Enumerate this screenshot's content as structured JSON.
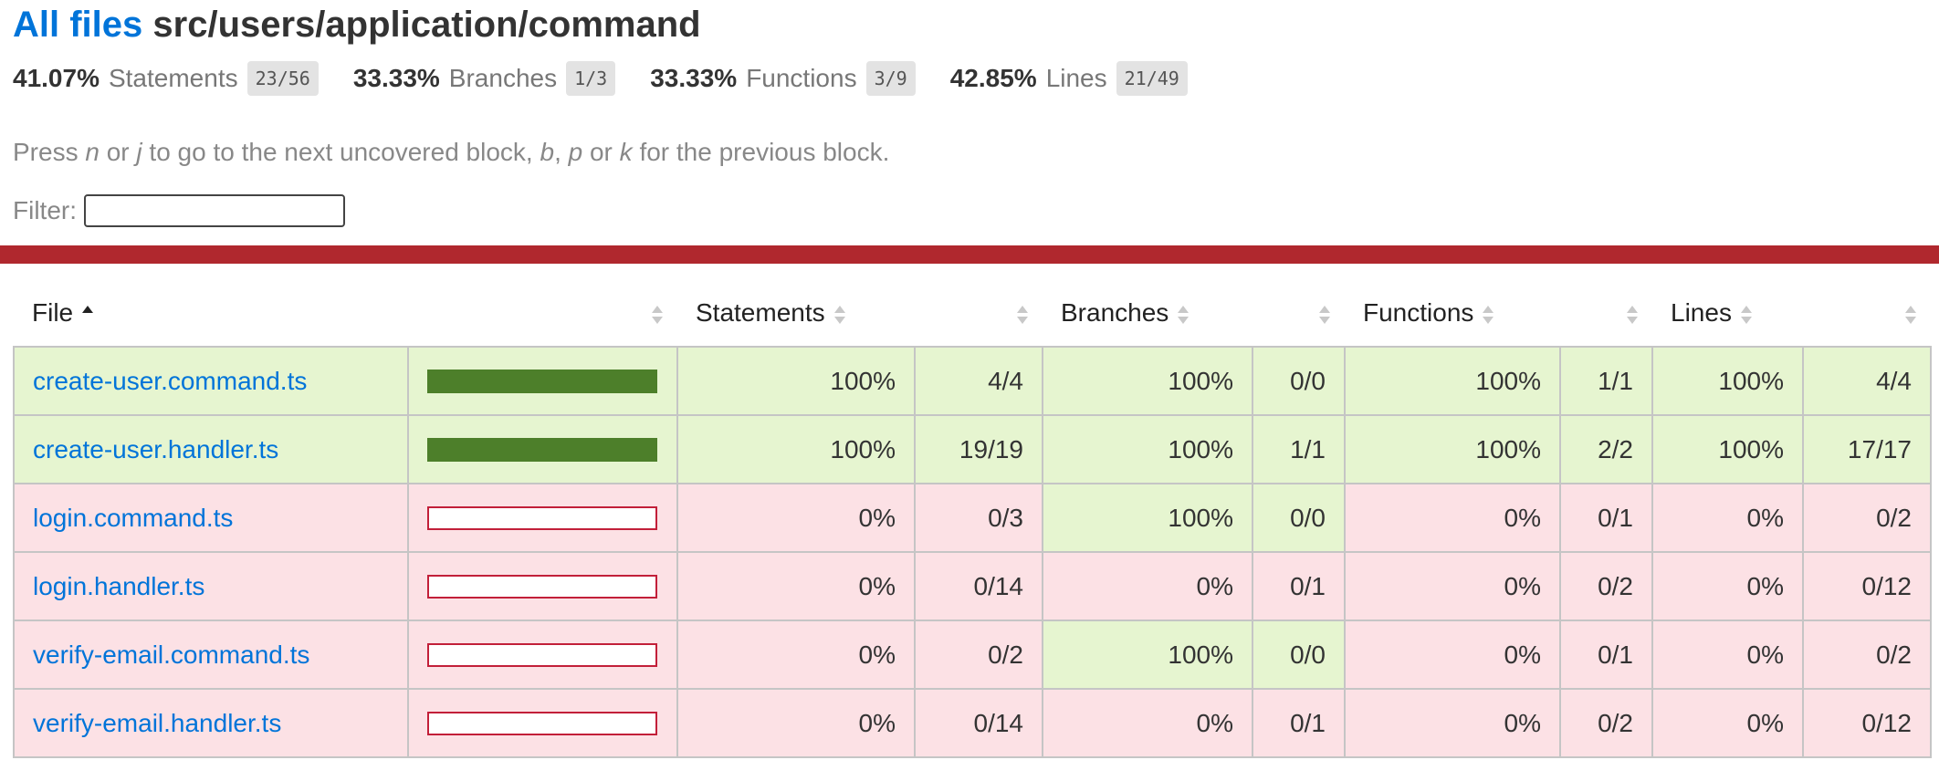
{
  "breadcrumb": {
    "root_link": "All files",
    "path": "src/users/application/command"
  },
  "summary": [
    {
      "pct": "41.07%",
      "label": "Statements",
      "fraction": "23/56"
    },
    {
      "pct": "33.33%",
      "label": "Branches",
      "fraction": "1/3"
    },
    {
      "pct": "33.33%",
      "label": "Functions",
      "fraction": "3/9"
    },
    {
      "pct": "42.85%",
      "label": "Lines",
      "fraction": "21/49"
    }
  ],
  "help": {
    "t1": "Press ",
    "k1": "n",
    "t2": " or ",
    "k2": "j",
    "t3": " to go to the next uncovered block, ",
    "k3": "b",
    "t4": ", ",
    "k4": "p",
    "t5": " or ",
    "k5": "k",
    "t6": " for the previous block."
  },
  "filter": {
    "label": "Filter:",
    "value": ""
  },
  "table": {
    "headers": {
      "file": "File",
      "statements": "Statements",
      "branches": "Branches",
      "functions": "Functions",
      "lines": "Lines"
    },
    "rows": [
      {
        "file": "create-user.command.ts",
        "coverage": 100,
        "status": "high",
        "statements": {
          "pct": "100%",
          "frac": "4/4",
          "status": "high"
        },
        "branches": {
          "pct": "100%",
          "frac": "0/0",
          "status": "high"
        },
        "functions": {
          "pct": "100%",
          "frac": "1/1",
          "status": "high"
        },
        "lines": {
          "pct": "100%",
          "frac": "4/4",
          "status": "high"
        }
      },
      {
        "file": "create-user.handler.ts",
        "coverage": 100,
        "status": "high",
        "statements": {
          "pct": "100%",
          "frac": "19/19",
          "status": "high"
        },
        "branches": {
          "pct": "100%",
          "frac": "1/1",
          "status": "high"
        },
        "functions": {
          "pct": "100%",
          "frac": "2/2",
          "status": "high"
        },
        "lines": {
          "pct": "100%",
          "frac": "17/17",
          "status": "high"
        }
      },
      {
        "file": "login.command.ts",
        "coverage": 0,
        "status": "low",
        "statements": {
          "pct": "0%",
          "frac": "0/3",
          "status": "low"
        },
        "branches": {
          "pct": "100%",
          "frac": "0/0",
          "status": "high"
        },
        "functions": {
          "pct": "0%",
          "frac": "0/1",
          "status": "low"
        },
        "lines": {
          "pct": "0%",
          "frac": "0/2",
          "status": "low"
        }
      },
      {
        "file": "login.handler.ts",
        "coverage": 0,
        "status": "low",
        "statements": {
          "pct": "0%",
          "frac": "0/14",
          "status": "low"
        },
        "branches": {
          "pct": "0%",
          "frac": "0/1",
          "status": "low"
        },
        "functions": {
          "pct": "0%",
          "frac": "0/2",
          "status": "low"
        },
        "lines": {
          "pct": "0%",
          "frac": "0/12",
          "status": "low"
        }
      },
      {
        "file": "verify-email.command.ts",
        "coverage": 0,
        "status": "low",
        "statements": {
          "pct": "0%",
          "frac": "0/2",
          "status": "low"
        },
        "branches": {
          "pct": "100%",
          "frac": "0/0",
          "status": "high"
        },
        "functions": {
          "pct": "0%",
          "frac": "0/1",
          "status": "low"
        },
        "lines": {
          "pct": "0%",
          "frac": "0/2",
          "status": "low"
        }
      },
      {
        "file": "verify-email.handler.ts",
        "coverage": 0,
        "status": "low",
        "statements": {
          "pct": "0%",
          "frac": "0/14",
          "status": "low"
        },
        "branches": {
          "pct": "0%",
          "frac": "0/1",
          "status": "low"
        },
        "functions": {
          "pct": "0%",
          "frac": "0/2",
          "status": "low"
        },
        "lines": {
          "pct": "0%",
          "frac": "0/12",
          "status": "low"
        }
      }
    ]
  },
  "colors": {
    "high_bg": "#e6f5d0",
    "low_bg": "#fce1e5",
    "bar_fill": "#4d7f2a",
    "bar_empty_border": "#c21f39",
    "status_line": "#b0282e",
    "link": "#0074D9"
  }
}
